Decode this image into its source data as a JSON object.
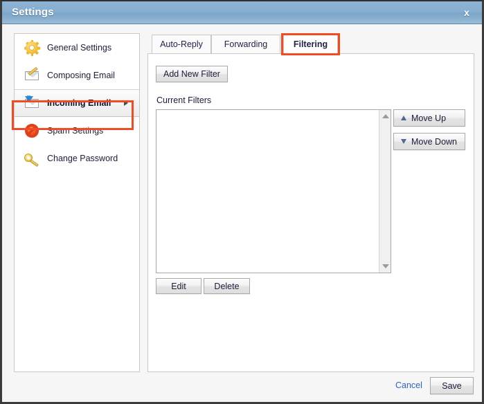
{
  "window": {
    "title": "Settings",
    "close_label": "x"
  },
  "sidebar": {
    "items": [
      {
        "label": "General Settings",
        "icon": "gear-icon",
        "selected": false,
        "has_arrow": false
      },
      {
        "label": "Composing Email",
        "icon": "envelope-pencil-icon",
        "selected": false,
        "has_arrow": false
      },
      {
        "label": "Incoming Email",
        "icon": "envelope-down-arrow-icon",
        "selected": true,
        "has_arrow": true
      },
      {
        "label": "Spam Settings",
        "icon": "prohibition-icon",
        "selected": false,
        "has_arrow": false
      },
      {
        "label": "Change Password",
        "icon": "key-icon",
        "selected": false,
        "has_arrow": false
      }
    ]
  },
  "tabs": [
    {
      "label": "Auto-Reply",
      "active": false
    },
    {
      "label": "Forwarding",
      "active": false
    },
    {
      "label": "Filtering",
      "active": true
    }
  ],
  "main": {
    "add_new_filter_label": "Add New Filter",
    "current_filters_label": "Current Filters",
    "filters_list": [],
    "move_up_label": "Move Up",
    "move_down_label": "Move Down",
    "edit_label": "Edit",
    "delete_label": "Delete"
  },
  "footer": {
    "cancel_label": "Cancel",
    "save_label": "Save"
  },
  "colors": {
    "titlebar_blue": "#87aecf",
    "highlight_red": "#f04b22",
    "link_blue": "#2a63c7",
    "panel_border": "#c8c8c8"
  }
}
